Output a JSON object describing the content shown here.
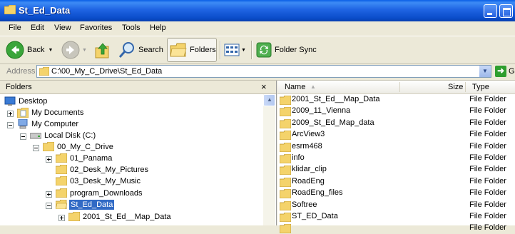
{
  "window": {
    "title": "St_Ed_Data"
  },
  "menu": [
    "File",
    "Edit",
    "View",
    "Favorites",
    "Tools",
    "Help"
  ],
  "toolbar": {
    "back": "Back",
    "search": "Search",
    "folders": "Folders",
    "folder_sync": "Folder Sync"
  },
  "address": {
    "label": "Address",
    "value": "C:\\00_My_C_Drive\\St_Ed_Data",
    "go": "G"
  },
  "folders_pane": {
    "title": "Folders",
    "close": "×",
    "tree": [
      {
        "label": "Desktop",
        "icon": "desktop-icon"
      },
      {
        "label": "My Documents",
        "icon": "documents-icon"
      },
      {
        "label": "My Computer",
        "icon": "computer-icon"
      },
      {
        "label": "Local Disk (C:)",
        "icon": "drive-icon"
      },
      {
        "label": "00_My_C_Drive",
        "icon": "folder-icon"
      },
      {
        "label": "01_Panama",
        "icon": "folder-icon"
      },
      {
        "label": "02_Desk_My_Pictures",
        "icon": "folder-icon"
      },
      {
        "label": "03_Desk_My_Music",
        "icon": "folder-icon"
      },
      {
        "label": "program_Downloads",
        "icon": "folder-icon"
      },
      {
        "label": "St_Ed_Data",
        "icon": "folder-open-icon",
        "selected": true
      },
      {
        "label": "2001_St_Ed__Map_Data",
        "icon": "folder-icon"
      }
    ]
  },
  "files_pane": {
    "columns": {
      "name": "Name",
      "size": "Size",
      "type": "Type"
    },
    "rows": [
      {
        "name": "2001_St_Ed__Map_Data",
        "type": "File Folder"
      },
      {
        "name": "2009_11_Vienna",
        "type": "File Folder"
      },
      {
        "name": "2009_St_Ed_Map_data",
        "type": "File Folder"
      },
      {
        "name": "ArcView3",
        "type": "File Folder"
      },
      {
        "name": "esrm468",
        "type": "File Folder"
      },
      {
        "name": "info",
        "type": "File Folder"
      },
      {
        "name": "klidar_clip",
        "type": "File Folder"
      },
      {
        "name": "RoadEng",
        "type": "File Folder"
      },
      {
        "name": "RoadEng_files",
        "type": "File Folder"
      },
      {
        "name": "Softree",
        "type": "File Folder"
      },
      {
        "name": "ST_ED_Data",
        "type": "File Folder"
      },
      {
        "name": "",
        "type": "File Folder"
      }
    ]
  },
  "colors": {
    "titlebar": "#0A4CC9",
    "selection": "#316AC5",
    "folder": "#F4D36B"
  }
}
